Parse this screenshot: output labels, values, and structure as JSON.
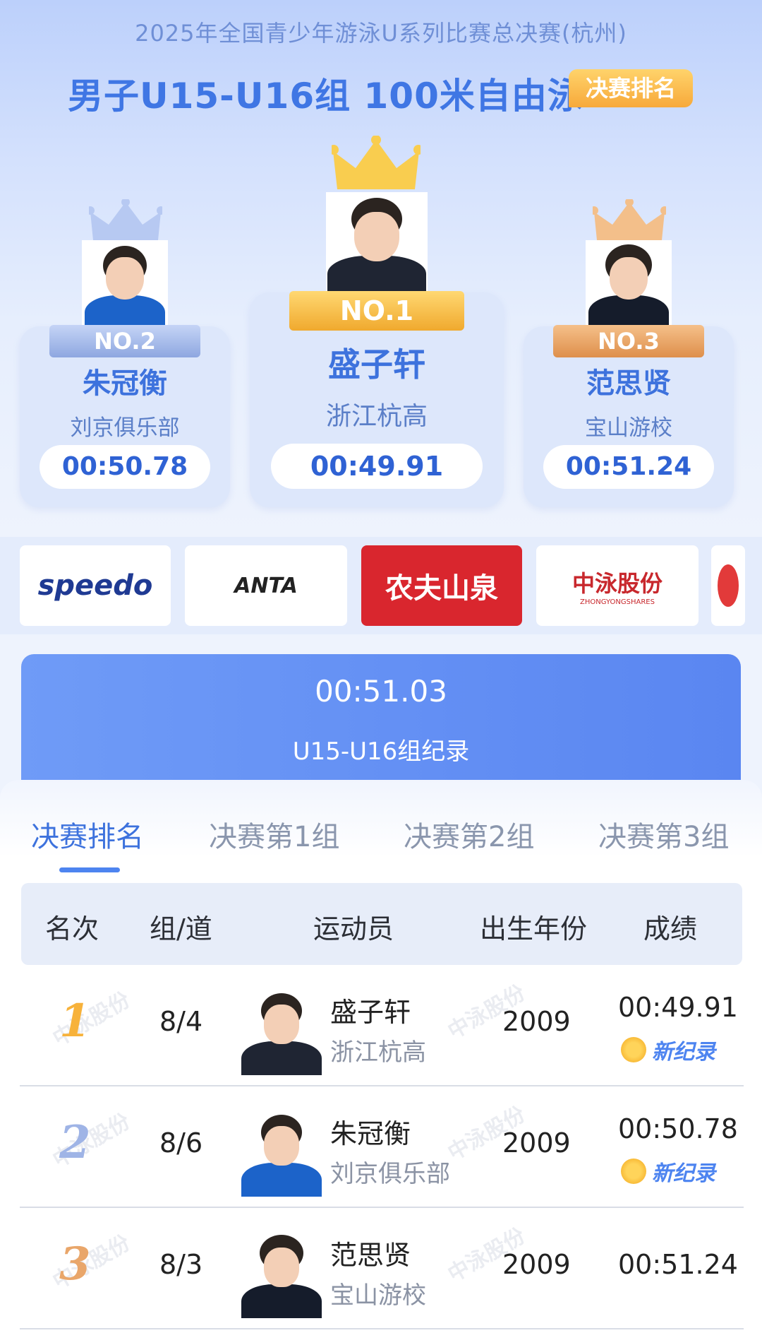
{
  "header": {
    "event_title": "2025年全国青少年游泳U系列比赛总决赛(杭州)",
    "event_name": "男子U15-U16组 100米自由泳",
    "badge": "决赛排名"
  },
  "podium": {
    "first": {
      "rank_label": "NO.1",
      "name": "盛子轩",
      "club": "浙江杭高",
      "time": "00:49.91"
    },
    "second": {
      "rank_label": "NO.2",
      "name": "朱冠衡",
      "club": "刘京俱乐部",
      "time": "00:50.78"
    },
    "third": {
      "rank_label": "NO.3",
      "name": "范思贤",
      "club": "宝山游校",
      "time": "00:51.24"
    }
  },
  "sponsors": [
    {
      "name": "speedo",
      "bg": "#ffffff",
      "color": "#1f3a93"
    },
    {
      "name": "ANTA",
      "bg": "#ffffff",
      "color": "#d6141c"
    },
    {
      "name": "农夫山泉",
      "bg": "#d9262e",
      "color": "#ffffff"
    },
    {
      "name": "中泳股份",
      "sub": "ZHONGYONGSHARES",
      "bg": "#ffffff",
      "color": "#c8282d"
    }
  ],
  "record": {
    "time": "00:51.03",
    "label": "U15-U16组纪录"
  },
  "tabs": [
    {
      "label": "决赛排名",
      "active": true
    },
    {
      "label": "决赛第1组",
      "active": false
    },
    {
      "label": "决赛第2组",
      "active": false
    },
    {
      "label": "决赛第3组",
      "active": false
    }
  ],
  "table": {
    "headers": [
      "名次",
      "组/道",
      "运动员",
      "出生年份",
      "成绩"
    ],
    "rows": [
      {
        "rank": "1",
        "lane": "8/4",
        "name": "盛子轩",
        "club": "浙江杭高",
        "year": "2009",
        "time": "00:49.91",
        "record": "新纪录"
      },
      {
        "rank": "2",
        "lane": "8/6",
        "name": "朱冠衡",
        "club": "刘京俱乐部",
        "year": "2009",
        "time": "00:50.78",
        "record": "新纪录"
      },
      {
        "rank": "3",
        "lane": "8/3",
        "name": "范思贤",
        "club": "宝山游校",
        "year": "2009",
        "time": "00:51.24",
        "record": ""
      }
    ]
  },
  "watermark": "中泳股份",
  "colors": {
    "accent": "#3d72dd",
    "gold": "#f7b23b",
    "silver": "#9fb4e6",
    "bronze": "#e9a66a"
  }
}
